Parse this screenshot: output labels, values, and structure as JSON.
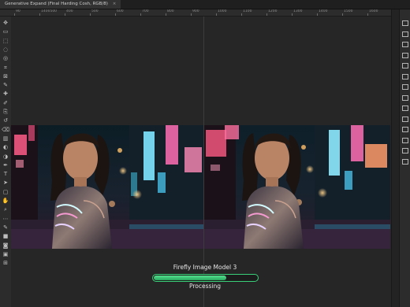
{
  "document_tab": {
    "title": "Generative Expand",
    "info": "(Final Harding Cosh, RGB/8)",
    "close_glyph": "×"
  },
  "ruler": {
    "labels": [
      "90",
      "1400500",
      "400",
      "500",
      "600",
      "700",
      "800",
      "900",
      "1000",
      "1100",
      "1200",
      "1300",
      "1400",
      "1500",
      "1600"
    ]
  },
  "toolbar": {
    "tools": [
      "move-tool",
      "artboard-tool",
      "marquee-tool",
      "lasso-tool",
      "object-select-tool",
      "crop-tool",
      "frame-tool",
      "eyedropper-tool",
      "healing-brush-tool",
      "brush-tool",
      "clone-stamp-tool",
      "history-brush-tool",
      "eraser-tool",
      "gradient-tool",
      "blur-tool",
      "dodge-tool",
      "pen-tool",
      "type-tool",
      "path-select-tool",
      "shape-tool",
      "hand-tool",
      "zoom-tool",
      "more-tools",
      "edit-toolbar",
      "color-swatches",
      "quick-mask",
      "screen-mode",
      "frame-tool"
    ]
  },
  "right_panels": {
    "icons": [
      "layers-icon",
      "properties-icon",
      "adjustments-icon",
      "libraries-icon",
      "channels-icon",
      "paths-icon",
      "history-icon",
      "actions-icon",
      "brushes-icon",
      "swatches-icon",
      "character-icon",
      "paragraph-icon",
      "glyphs-icon",
      "info-icon"
    ]
  },
  "generation": {
    "model_label": "Firefly Image Model 3",
    "status_label": "Processing",
    "progress_percent": 70,
    "accent_color": "#3ad07a"
  }
}
